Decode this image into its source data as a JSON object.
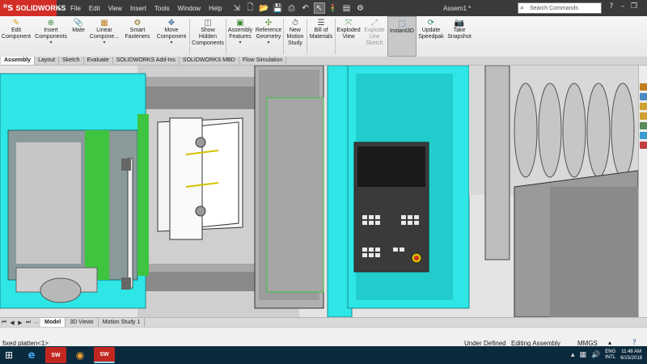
{
  "titlebar": {
    "brand": "SOLIDWORKS",
    "menu": [
      "File",
      "Edit",
      "View",
      "Insert",
      "Tools",
      "Window",
      "Help"
    ],
    "document_title": "Assem1 *",
    "search_placeholder": "Search Commands"
  },
  "command_manager": {
    "tools": [
      {
        "label": "Edit\nComponent"
      },
      {
        "label": "Insert\nComponents"
      },
      {
        "label": "Mate"
      },
      {
        "label": "Linear\nCompone..."
      },
      {
        "label": "Smart\nFasteners"
      },
      {
        "label": "Move\nComponent"
      },
      {
        "label": "Show\nHidden\nComponents"
      },
      {
        "label": "Assembly\nFeatures"
      },
      {
        "label": "Reference\nGeometry"
      },
      {
        "label": "New\nMotion\nStudy"
      },
      {
        "label": "Bill of\nMaterials"
      },
      {
        "label": "Exploded\nView"
      },
      {
        "label": "Explode\nLine\nSketch"
      },
      {
        "label": "Instant3D"
      },
      {
        "label": "Update\nSpeedpak"
      },
      {
        "label": "Take\nSnapshot"
      }
    ]
  },
  "tabs": [
    "Assembly",
    "Layout",
    "Sketch",
    "Evaluate",
    "SOLIDWORKS Add-Ins",
    "SOLIDWORKS MBD",
    "Flow Simulation"
  ],
  "model_tabs": [
    "Model",
    "3D Views",
    "Motion Study 1"
  ],
  "status": {
    "selection": "fixed platten<1>",
    "state": "Under Defined",
    "mode": "Editing Assembly",
    "units": "MMGS"
  },
  "taskbar": {
    "apps": [
      "Internet Explorer",
      "SOLIDWORKS 2015",
      "Firefox",
      "SOLIDWORKS 2015"
    ],
    "lang_line1": "ENG",
    "lang_line2": "INTL",
    "time": "11:48 AM",
    "date": "6/15/2018"
  },
  "colors": {
    "cyan": "#2ee6e6",
    "dark_teal": "#1aa5a5",
    "green": "#3ec43e",
    "brand_red": "#d32d27",
    "titlebar": "#3a3a3a",
    "taskbar": "#0c2a3e"
  }
}
